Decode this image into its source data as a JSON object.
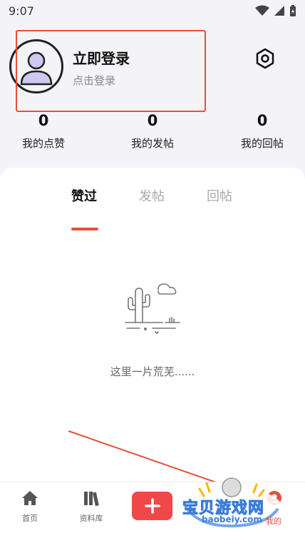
{
  "status_bar": {
    "time": "9:07"
  },
  "profile": {
    "login_title": "立即登录",
    "login_subtitle": "点击登录"
  },
  "stats": [
    {
      "value": "0",
      "label": "我的点赞"
    },
    {
      "value": "0",
      "label": "我的发帖"
    },
    {
      "value": "0",
      "label": "我的回帖"
    }
  ],
  "tabs": [
    {
      "label": "赞过",
      "active": true
    },
    {
      "label": "发帖",
      "active": false
    },
    {
      "label": "回帖",
      "active": false
    }
  ],
  "empty_state": {
    "text": "这里一片荒芜......"
  },
  "bottom_nav": {
    "home": "首页",
    "library": "资料库",
    "mine": "我的"
  },
  "watermark": {
    "text": "宝贝游戏网",
    "url": "baobeiy.com"
  },
  "colors": {
    "accent": "#e4513a",
    "add_button": "#f04848"
  }
}
